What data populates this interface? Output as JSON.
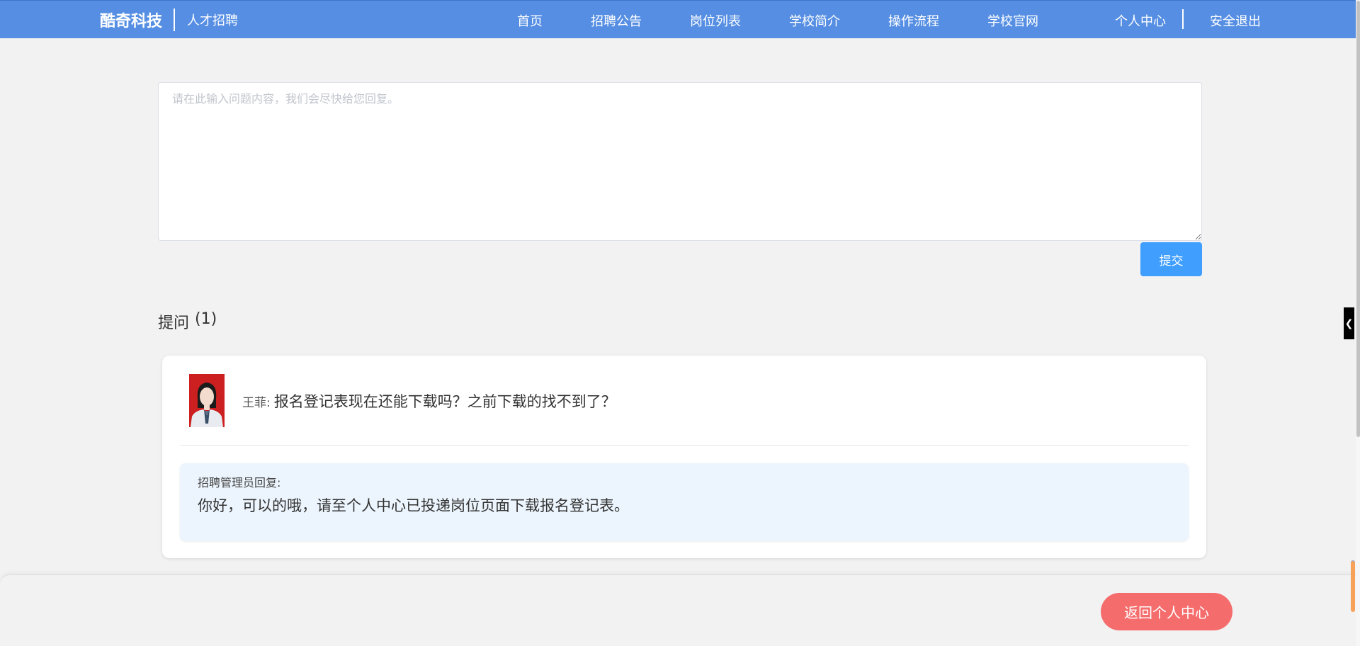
{
  "header": {
    "brand": "酷奇科技",
    "subtitle": "人才招聘",
    "nav": [
      "首页",
      "招聘公告",
      "岗位列表",
      "学校简介",
      "操作流程",
      "学校官网"
    ],
    "user_center": "个人中心",
    "logout": "安全退出"
  },
  "question_form": {
    "placeholder": "请在此输入问题内容，我们会尽快给您回复。",
    "value": "",
    "submit_label": "提交"
  },
  "questions": {
    "title": "提问",
    "count": "(1)",
    "items": [
      {
        "asker": "王菲:",
        "text": "报名登记表现在还能下载吗？之前下载的找不到了？",
        "reply_label": "招聘管理员回复:",
        "reply_text": "你好，可以的哦，请至个人中心已投递岗位页面下载报名登记表。"
      }
    ]
  },
  "footer": {
    "back_label": "返回个人中心"
  },
  "colors": {
    "header_bg": "#558ee3",
    "primary": "#409eff",
    "danger": "#f56c6c",
    "reply_bg": "#ecf5fd"
  }
}
